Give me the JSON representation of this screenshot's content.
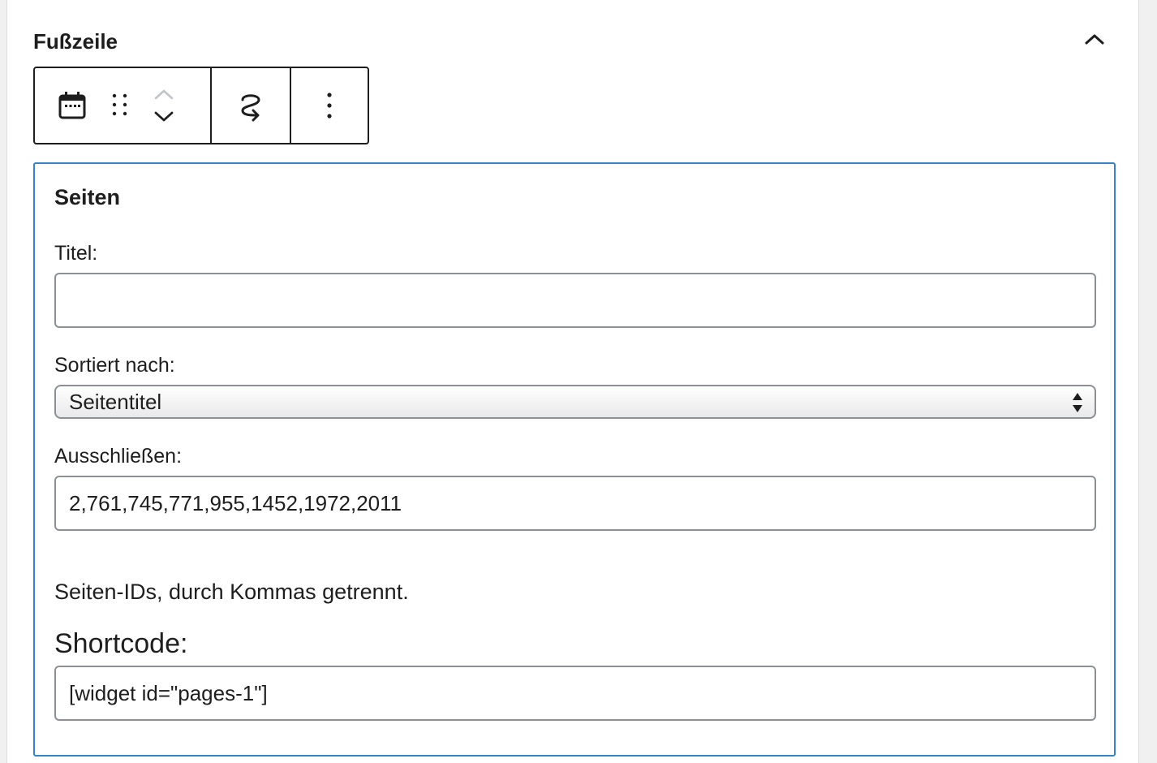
{
  "panel": {
    "title": "Fußzeile"
  },
  "toolbar": {
    "block_icon": "calendar-icon",
    "drag_icon": "drag-handle-icon",
    "move_up_icon": "chevron-up-icon",
    "move_down_icon": "chevron-down-icon",
    "transform_icon": "transform-loop-icon",
    "more_icon": "more-vertical-icon"
  },
  "widget": {
    "title": "Seiten",
    "title_label": "Titel:",
    "title_value": "",
    "sort_label": "Sortiert nach:",
    "sort_selected": "Seitentitel",
    "exclude_label": "Ausschließen:",
    "exclude_value": "2,761,745,771,955,1452,1972,2011",
    "help_text": "Seiten-IDs, durch Kommas getrennt.",
    "shortcode_label": "Shortcode:",
    "shortcode_value": "[widget id=\"pages-1\"]"
  },
  "colors": {
    "accent": "#3582c4",
    "border": "#8c8f94",
    "text": "#1e1e1e"
  }
}
